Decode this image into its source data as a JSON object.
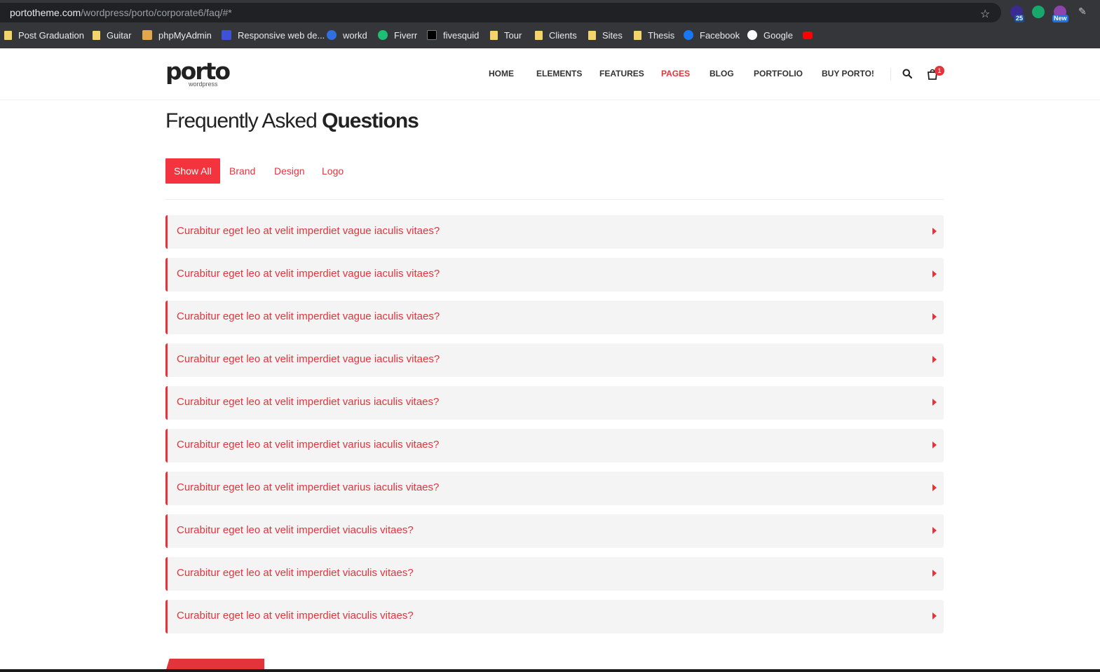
{
  "browser": {
    "url_host": "portotheme.com",
    "url_path": "/wordpress/porto/corporate6/faq/#*",
    "extensions": {
      "badge_count": "25",
      "badge_new": "New"
    },
    "bookmarks": [
      {
        "label": "Post Graduation",
        "icon": "folder-icon"
      },
      {
        "label": "Guitar",
        "icon": "folder-icon"
      },
      {
        "label": "phpMyAdmin",
        "icon": "phpmyadmin-icon"
      },
      {
        "label": "Responsive web de...",
        "icon": "w-icon"
      },
      {
        "label": "workd",
        "icon": "workd-icon"
      },
      {
        "label": "Fiverr",
        "icon": "fiverr-icon"
      },
      {
        "label": "fivesquid",
        "icon": "fivesquid-icon"
      },
      {
        "label": "Tour",
        "icon": "folder-icon"
      },
      {
        "label": "Clients",
        "icon": "folder-icon"
      },
      {
        "label": "Sites",
        "icon": "folder-icon"
      },
      {
        "label": "Thesis",
        "icon": "folder-icon"
      },
      {
        "label": "Facebook",
        "icon": "facebook-icon"
      },
      {
        "label": "Google",
        "icon": "google-icon"
      },
      {
        "label": "",
        "icon": "youtube-icon"
      }
    ]
  },
  "header": {
    "logo_main": "porto",
    "logo_sub": "wordpress",
    "nav": [
      "HOME",
      "ELEMENTS",
      "FEATURES",
      "PAGES",
      "BLOG",
      "PORTFOLIO",
      "BUY PORTO!"
    ],
    "active_nav": "PAGES",
    "cart_count": "1"
  },
  "main": {
    "title_light": "Frequently Asked",
    "title_bold": "Questions",
    "filters": [
      "Show All",
      "Brand",
      "Design",
      "Logo"
    ],
    "active_filter": "Show All",
    "faqs": [
      "Curabitur eget leo at velit imperdiet vague iaculis vitaes?",
      "Curabitur eget leo at velit imperdiet vague iaculis vitaes?",
      "Curabitur eget leo at velit imperdiet vague iaculis vitaes?",
      "Curabitur eget leo at velit imperdiet vague iaculis vitaes?",
      "Curabitur eget leo at velit imperdiet varius iaculis vitaes?",
      "Curabitur eget leo at velit imperdiet varius iaculis vitaes?",
      "Curabitur eget leo at velit imperdiet varius iaculis vitaes?",
      "Curabitur eget leo at velit imperdiet viaculis vitaes?",
      "Curabitur eget leo at velit imperdiet viaculis vitaes?",
      "Curabitur eget leo at velit imperdiet viaculis vitaes?"
    ]
  },
  "colors": {
    "accent": "#e3343c",
    "filter_active_bg": "#f3333d",
    "faq_bg": "#f4f4f4",
    "chrome_bg": "#35363a"
  }
}
